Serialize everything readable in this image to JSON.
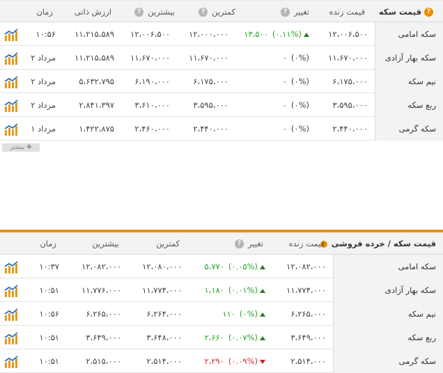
{
  "panel1": {
    "headers": {
      "name": "قیمت سکه",
      "price": "قیمت زنده",
      "change": "تغییر",
      "low": "کمترین",
      "high": "بیشترین",
      "intrinsic": "ارزش ذاتی",
      "time": "زمان"
    },
    "rows": [
      {
        "name": "سکه امامی",
        "price": "۱۲،۰۰۶،۵۰۰",
        "change_value": "۱۳،۵۰۰",
        "change_pct": "(۰.۱۱%)",
        "direction": "up",
        "low": "۱۲،۰۰۰،۰۰۰",
        "high": "۱۲،۰۰۶،۵۰۰",
        "intrinsic": "۱۱،۲۱۵،۵۸۹",
        "time": "۱۰:۵۶"
      },
      {
        "name": "سکه بهار آزادی",
        "price": "۱۱،۶۷۰،۰۰۰",
        "change_value": "۰",
        "change_pct": "(۰%)",
        "direction": "none",
        "low": "۱۱،۶۷۰،۰۰۰",
        "high": "۱۱،۶۷۰،۰۰۰",
        "intrinsic": "۱۱،۲۱۵،۵۸۹",
        "time": "۲ مرداد"
      },
      {
        "name": "نیم سکه",
        "price": "۶،۱۷۵،۰۰۰",
        "change_value": "۰",
        "change_pct": "(۰%)",
        "direction": "none",
        "low": "۶،۱۷۵،۰۰۰",
        "high": "۶،۱۹۰،۰۰۰",
        "intrinsic": "۵،۶۳۲،۷۹۵",
        "time": "۲ مرداد"
      },
      {
        "name": "ربع سکه",
        "price": "۳،۵۹۵،۰۰۰",
        "change_value": "۰",
        "change_pct": "(۰%)",
        "direction": "none",
        "low": "۳،۵۹۵،۰۰۰",
        "high": "۳،۶۱۰،۰۰۰",
        "intrinsic": "۲،۸۴۱،۳۹۷",
        "time": "۲ مرداد"
      },
      {
        "name": "سکه گرمی",
        "price": "۲،۴۴۰،۰۰۰",
        "change_value": "۰",
        "change_pct": "(۰%)",
        "direction": "none",
        "low": "۲،۴۴۰،۰۰۰",
        "high": "۲،۴۶۰،۰۰۰",
        "intrinsic": "۱،۴۲۲،۸۷۵",
        "time": "۱ مرداد"
      }
    ],
    "more_label": "بیشتر"
  },
  "panel2": {
    "headers": {
      "name": "قیمت سکه / خرده فروشی",
      "price": "قیمت زنده",
      "change": "تغییر",
      "low": "کمترین",
      "high": "بیشترین",
      "time": "زمان"
    },
    "rows": [
      {
        "name": "سکه امامی",
        "price": "۱۲،۰۸۲،۰۰۰",
        "change_value": "۵،۷۷۰",
        "change_pct": "(۰.۰۵%)",
        "direction": "up",
        "low": "۱۲،۰۸۰،۰۰۰",
        "high": "۱۲،۰۸۲،۰۰۰",
        "time": "۱۰:۳۷"
      },
      {
        "name": "سکه بهار آزادی",
        "price": "۱۱،۷۷۴،۰۰۰",
        "change_value": "۱،۱۸۰",
        "change_pct": "(۰.۰۱%)",
        "direction": "up",
        "low": "۱۱،۷۷۴،۰۰۰",
        "high": "۱۱،۷۷۶،۰۰۰",
        "time": "۱۰:۵۱"
      },
      {
        "name": "نیم سکه",
        "price": "۶،۲۶۵،۰۰۰",
        "change_value": "۱۱۰",
        "change_pct": "(۰%)",
        "direction": "up",
        "low": "۶،۲۶۴،۰۰۰",
        "high": "۶،۲۶۵،۰۰۰",
        "time": "۱۰:۵۶"
      },
      {
        "name": "ربع سکه",
        "price": "۳،۶۴۹،۰۰۰",
        "change_value": "۲،۶۶۰",
        "change_pct": "(۰.۰۷%)",
        "direction": "up",
        "low": "۳،۶۴۸،۰۰۰",
        "high": "۳،۶۴۹،۰۰۰",
        "time": "۱۰:۵۱"
      },
      {
        "name": "سکه گرمی",
        "price": "۲،۵۱۴،۰۰۰",
        "change_value": "۲،۲۹۰",
        "change_pct": "(۰.۰۹%)",
        "direction": "down",
        "low": "۲،۵۱۴،۰۰۰",
        "high": "۲،۵۱۵،۰۰۰",
        "time": "۱۰:۵۱"
      }
    ]
  },
  "icons": {
    "help": "question-icon",
    "chart": "chart-icon"
  },
  "colors": {
    "accent": "#f08c00",
    "up": "#2aa02a",
    "down": "#d92c2c"
  }
}
